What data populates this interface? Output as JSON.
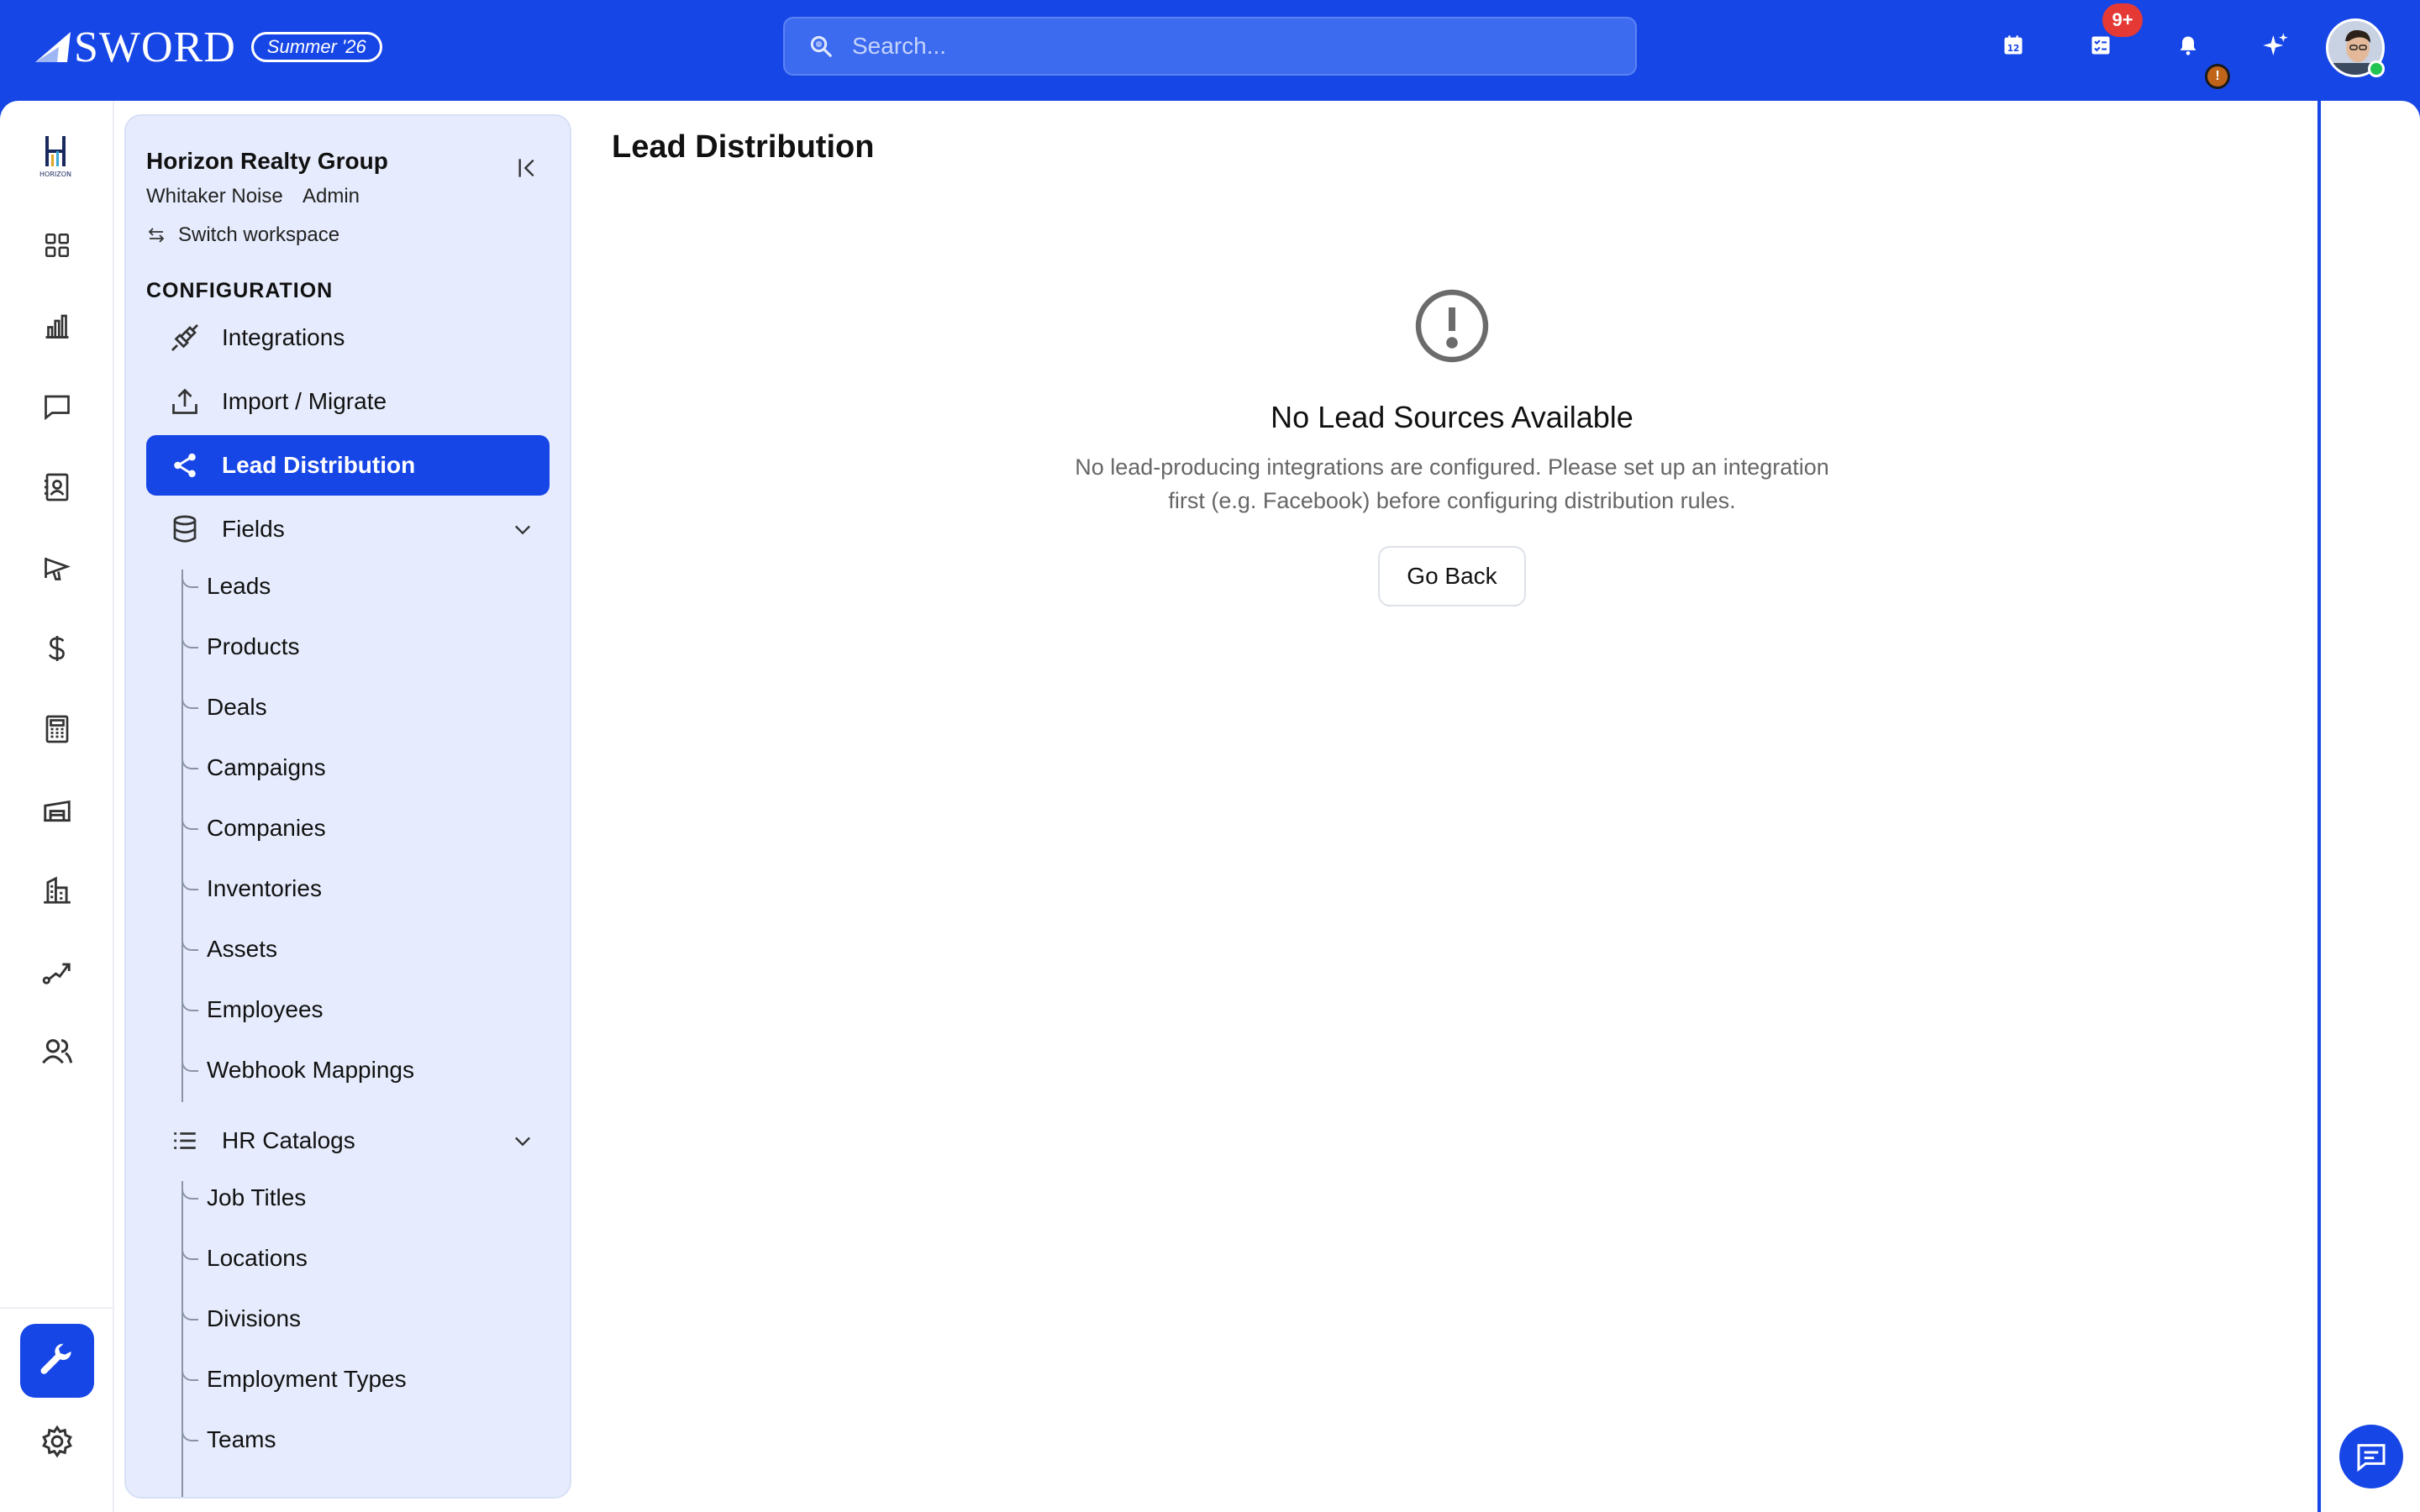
{
  "brand": {
    "name": "SWORD",
    "season": "Summer '26"
  },
  "search": {
    "placeholder": "Search..."
  },
  "top_icons": {
    "calendar_day": "12",
    "tasks_badge": "9+",
    "notification_badge": "!"
  },
  "rail": {
    "logo_text": "HORIZON",
    "items": [
      "dashboard",
      "analytics",
      "messages",
      "contacts",
      "campaigns",
      "finance",
      "calculator",
      "warehouse",
      "buildings",
      "workflow",
      "team"
    ]
  },
  "panel": {
    "org_name": "Horizon Realty Group",
    "user_name": "Whitaker Noise",
    "user_role": "Admin",
    "switch_label": "Switch workspace",
    "section_title": "CONFIGURATION",
    "nav": {
      "integrations": "Integrations",
      "import": "Import / Migrate",
      "lead_distribution": "Lead Distribution",
      "fields": "Fields",
      "hr_catalogs": "HR Catalogs"
    },
    "fields_children": [
      "Leads",
      "Products",
      "Deals",
      "Campaigns",
      "Companies",
      "Inventories",
      "Assets",
      "Employees",
      "Webhook Mappings"
    ],
    "hr_children": [
      "Job Titles",
      "Locations",
      "Divisions",
      "Employment Types",
      "Teams"
    ]
  },
  "main": {
    "title": "Lead Distribution",
    "empty_title": "No Lead Sources Available",
    "empty_text": "No lead-producing integrations are configured. Please set up an integration first (e.g. Facebook) before configuring distribution rules.",
    "go_back": "Go Back"
  },
  "colors": {
    "primary": "#1746e6",
    "panel_bg": "#e6ecfd",
    "badge": "#e53935"
  }
}
